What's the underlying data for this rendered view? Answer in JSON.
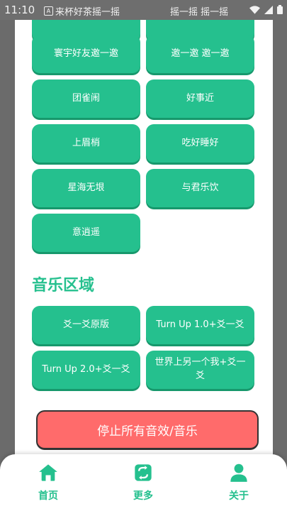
{
  "status_bar": {
    "time": "11:10",
    "app_icon_label": "A",
    "app_name": "来杯好茶摇一摇",
    "page_title": "摇一摇 摇一摇"
  },
  "sound_buttons": [
    {
      "label": "寰宇好友邀一邀"
    },
    {
      "label": "邀一邀 邀一邀"
    },
    {
      "label": "团雀闹"
    },
    {
      "label": "好事近"
    },
    {
      "label": "上眉梢"
    },
    {
      "label": "吃好睡好"
    },
    {
      "label": "星海无垠"
    },
    {
      "label": "与君乐饮"
    },
    {
      "label": "意逍遥"
    }
  ],
  "music_section": {
    "title": "音乐区域",
    "buttons": [
      {
        "label": "爻一爻原版"
      },
      {
        "label": "Turn Up 1.0+爻一爻"
      },
      {
        "label": "Turn Up 2.0+爻一爻"
      },
      {
        "label": "世界上另一个我+爻一爻"
      }
    ]
  },
  "stop_button": {
    "label": "停止所有音效/音乐"
  },
  "nav": {
    "items": [
      {
        "label": "首页",
        "icon": "home-icon"
      },
      {
        "label": "更多",
        "icon": "refresh-icon"
      },
      {
        "label": "关于",
        "icon": "user-icon"
      }
    ]
  },
  "colors": {
    "accent": "#25c08e",
    "button_shadow": "#17986c",
    "stop": "#ff6b6b",
    "backdrop": "#5c5c5c"
  }
}
